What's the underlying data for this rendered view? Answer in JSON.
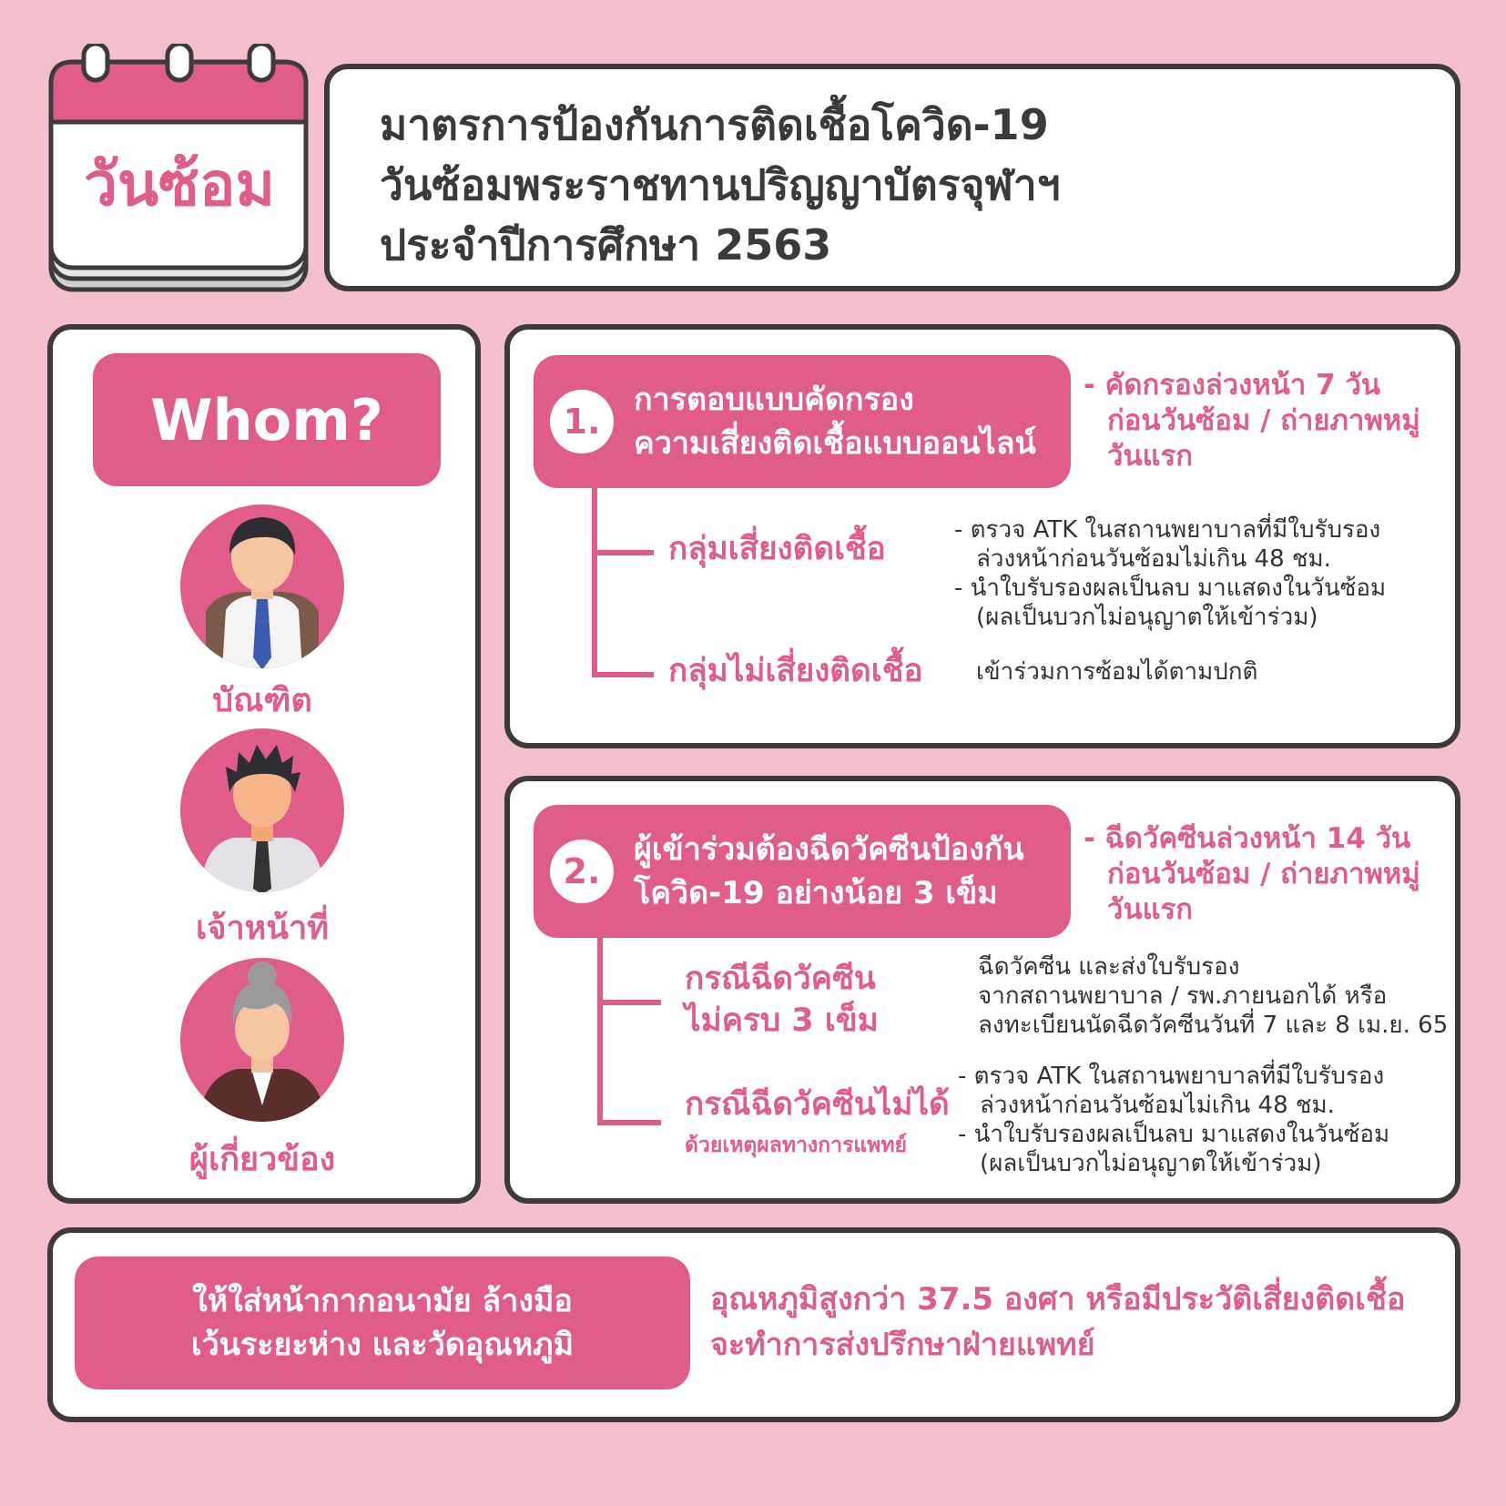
{
  "calendar": {
    "label": "วันซ้อม"
  },
  "title": {
    "lines": [
      "มาตรการป้องกันการติดเชื้อโควิด-19",
      "วันซ้อมพระราชทานปริญญาบัตรจุฬาฯ",
      "ประจำปีการศึกษา 2563"
    ]
  },
  "whom": {
    "heading": "Whom?",
    "people": [
      {
        "label": "บัณฑิต",
        "icon": "graduate-avatar-icon"
      },
      {
        "label": "เจ้าหน้าที่",
        "icon": "staff-avatar-icon"
      },
      {
        "label": "ผู้เกี่ยวข้อง",
        "icon": "elder-avatar-icon"
      }
    ]
  },
  "measure1": {
    "number": "1.",
    "title_lines": [
      "การตอบแบบคัดกรอง",
      "ความเสี่ยงติดเชื้อแบบออนไลน์"
    ],
    "note_lines": [
      "- คัดกรองล่วงหน้า 7 วัน",
      "ก่อนวันซ้อม / ถ่ายภาพหมู่",
      "วันแรก"
    ],
    "branches": [
      {
        "title": "กลุ่มเสี่ยงติดเชื้อ",
        "details": [
          "- ตรวจ ATK ในสถานพยาบาลที่มีใบรับรอง",
          "ล่วงหน้าก่อนวันซ้อมไม่เกิน 48 ชม.",
          "- นำใบรับรองผลเป็นลบ มาแสดงในวันซ้อม",
          "(ผลเป็นบวกไม่อนุญาตให้เข้าร่วม)"
        ]
      },
      {
        "title": "กลุ่มไม่เสี่ยงติดเชื้อ",
        "details": [
          "เข้าร่วมการซ้อมได้ตามปกติ"
        ]
      }
    ]
  },
  "measure2": {
    "number": "2.",
    "title_lines": [
      "ผู้เข้าร่วมต้องฉีดวัคซีนป้องกัน",
      "โควิด-19 อย่างน้อย 3 เข็ม"
    ],
    "note_lines": [
      "- ฉีดวัคซีนล่วงหน้า 14 วัน",
      "ก่อนวันซ้อม / ถ่ายภาพหมู่",
      "วันแรก"
    ],
    "branches": [
      {
        "title_lines": [
          "กรณีฉีดวัคซีน",
          "ไม่ครบ 3 เข็ม"
        ],
        "details": [
          "ฉีดวัคซีน และส่งใบรับรอง",
          "จากสถานพยาบาล / รพ.ภายนอกได้ หรือ",
          "ลงทะเบียนนัดฉีดวัคซีนวันที่ 7 และ 8 เม.ย. 65"
        ]
      },
      {
        "title": "กรณีฉีดวัคซีนไม่ได้",
        "subtitle": "ด้วยเหตุผลทางการแพทย์",
        "details": [
          "- ตรวจ ATK ในสถานพยาบาลที่มีใบรับรอง",
          "ล่วงหน้าก่อนวันซ้อมไม่เกิน 48 ชม.",
          "- นำใบรับรองผลเป็นลบ มาแสดงในวันซ้อม",
          "(ผลเป็นบวกไม่อนุญาตให้เข้าร่วม)"
        ]
      }
    ]
  },
  "bottom": {
    "pill_lines": [
      "ให้ใส่หน้ากากอนามัย ล้างมือ",
      "เว้นระยะห่าง และวัดอุณหภูมิ"
    ],
    "text_lines": [
      "อุณหภูมิสูงกว่า 37.5 องศา หรือมีประวัติเสี่ยงติดเชื้อ",
      "จะทำการส่งปรึกษาฝ่ายแพทย์"
    ]
  },
  "colors": {
    "background": "#f3bfcc",
    "accent": "#df5c8b",
    "outline": "#3d3a3c"
  }
}
